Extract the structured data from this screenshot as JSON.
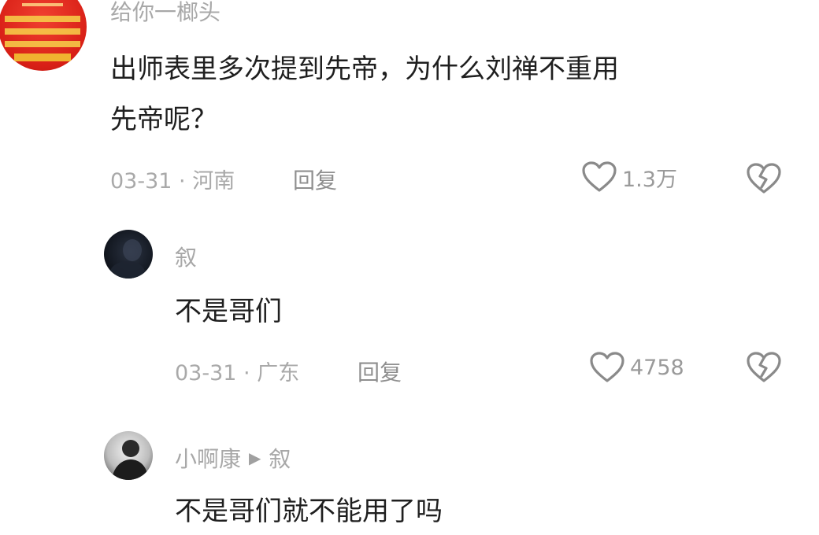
{
  "comments": [
    {
      "username": "给你一榔头",
      "text_lines": [
        "出师表里多次提到先帝，为什么刘禅不重用",
        "先帝呢？"
      ],
      "date": "03-31",
      "location": "河南",
      "reply_label": "回复",
      "like_count": "1.3万"
    },
    {
      "username": "叙",
      "text_lines": [
        "不是哥们"
      ],
      "date": "03-31",
      "location": "广东",
      "reply_label": "回复",
      "like_count": "4758"
    },
    {
      "username": "小啊康",
      "reply_to": "叙",
      "text_lines": [
        "不是哥们就不能用了吗"
      ]
    }
  ],
  "colors": {
    "muted_text": "#a8a8a8",
    "body_text": "#1f1f1f",
    "icon_stroke": "#8a8a8a",
    "avatar1_red": "#e3261c"
  },
  "icons": [
    "heart-outline-icon",
    "broken-heart-icon",
    "play-arrow-icon"
  ]
}
